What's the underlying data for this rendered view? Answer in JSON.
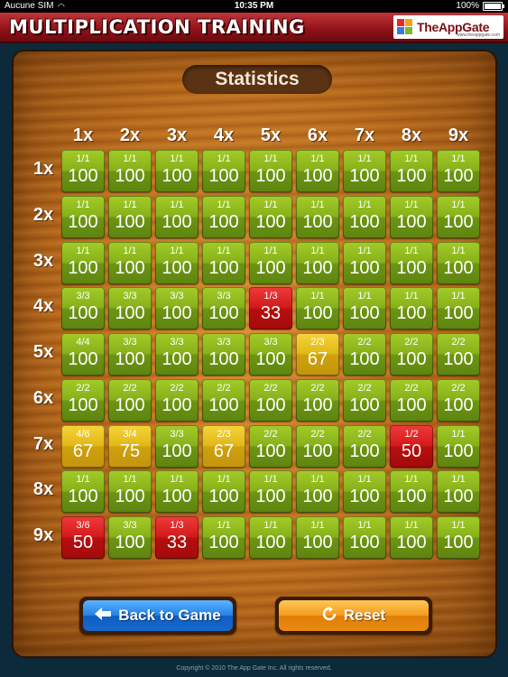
{
  "status": {
    "carrier": "Aucune SIM",
    "time": "10:35 PM",
    "battery": "100%"
  },
  "header": {
    "title": "MULTIPLICATION TRAINING",
    "brand": "TheAppGate",
    "brand_url": "www.theappgate.com"
  },
  "panel_title": "Statistics",
  "columns": [
    "1x",
    "2x",
    "3x",
    "4x",
    "5x",
    "6x",
    "7x",
    "8x",
    "9x"
  ],
  "rows": [
    "1x",
    "2x",
    "3x",
    "4x",
    "5x",
    "6x",
    "7x",
    "8x",
    "9x"
  ],
  "colors": {
    "green": "#86b11a",
    "yellow": "#e2b817",
    "red": "#d41a1a"
  },
  "cells": [
    [
      {
        "f": "1/1",
        "p": "100",
        "c": "green"
      },
      {
        "f": "1/1",
        "p": "100",
        "c": "green"
      },
      {
        "f": "1/1",
        "p": "100",
        "c": "green"
      },
      {
        "f": "1/1",
        "p": "100",
        "c": "green"
      },
      {
        "f": "1/1",
        "p": "100",
        "c": "green"
      },
      {
        "f": "1/1",
        "p": "100",
        "c": "green"
      },
      {
        "f": "1/1",
        "p": "100",
        "c": "green"
      },
      {
        "f": "1/1",
        "p": "100",
        "c": "green"
      },
      {
        "f": "1/1",
        "p": "100",
        "c": "green"
      }
    ],
    [
      {
        "f": "1/1",
        "p": "100",
        "c": "green"
      },
      {
        "f": "1/1",
        "p": "100",
        "c": "green"
      },
      {
        "f": "1/1",
        "p": "100",
        "c": "green"
      },
      {
        "f": "1/1",
        "p": "100",
        "c": "green"
      },
      {
        "f": "1/1",
        "p": "100",
        "c": "green"
      },
      {
        "f": "1/1",
        "p": "100",
        "c": "green"
      },
      {
        "f": "1/1",
        "p": "100",
        "c": "green"
      },
      {
        "f": "1/1",
        "p": "100",
        "c": "green"
      },
      {
        "f": "1/1",
        "p": "100",
        "c": "green"
      }
    ],
    [
      {
        "f": "1/1",
        "p": "100",
        "c": "green"
      },
      {
        "f": "1/1",
        "p": "100",
        "c": "green"
      },
      {
        "f": "1/1",
        "p": "100",
        "c": "green"
      },
      {
        "f": "1/1",
        "p": "100",
        "c": "green"
      },
      {
        "f": "1/1",
        "p": "100",
        "c": "green"
      },
      {
        "f": "1/1",
        "p": "100",
        "c": "green"
      },
      {
        "f": "1/1",
        "p": "100",
        "c": "green"
      },
      {
        "f": "1/1",
        "p": "100",
        "c": "green"
      },
      {
        "f": "1/1",
        "p": "100",
        "c": "green"
      }
    ],
    [
      {
        "f": "3/3",
        "p": "100",
        "c": "green"
      },
      {
        "f": "3/3",
        "p": "100",
        "c": "green"
      },
      {
        "f": "3/3",
        "p": "100",
        "c": "green"
      },
      {
        "f": "3/3",
        "p": "100",
        "c": "green"
      },
      {
        "f": "1/3",
        "p": "33",
        "c": "red"
      },
      {
        "f": "1/1",
        "p": "100",
        "c": "green"
      },
      {
        "f": "1/1",
        "p": "100",
        "c": "green"
      },
      {
        "f": "1/1",
        "p": "100",
        "c": "green"
      },
      {
        "f": "1/1",
        "p": "100",
        "c": "green"
      }
    ],
    [
      {
        "f": "4/4",
        "p": "100",
        "c": "green"
      },
      {
        "f": "3/3",
        "p": "100",
        "c": "green"
      },
      {
        "f": "3/3",
        "p": "100",
        "c": "green"
      },
      {
        "f": "3/3",
        "p": "100",
        "c": "green"
      },
      {
        "f": "3/3",
        "p": "100",
        "c": "green"
      },
      {
        "f": "2/3",
        "p": "67",
        "c": "yellow"
      },
      {
        "f": "2/2",
        "p": "100",
        "c": "green"
      },
      {
        "f": "2/2",
        "p": "100",
        "c": "green"
      },
      {
        "f": "2/2",
        "p": "100",
        "c": "green"
      }
    ],
    [
      {
        "f": "2/2",
        "p": "100",
        "c": "green"
      },
      {
        "f": "2/2",
        "p": "100",
        "c": "green"
      },
      {
        "f": "2/2",
        "p": "100",
        "c": "green"
      },
      {
        "f": "2/2",
        "p": "100",
        "c": "green"
      },
      {
        "f": "2/2",
        "p": "100",
        "c": "green"
      },
      {
        "f": "2/2",
        "p": "100",
        "c": "green"
      },
      {
        "f": "2/2",
        "p": "100",
        "c": "green"
      },
      {
        "f": "2/2",
        "p": "100",
        "c": "green"
      },
      {
        "f": "2/2",
        "p": "100",
        "c": "green"
      }
    ],
    [
      {
        "f": "4/6",
        "p": "67",
        "c": "yellow"
      },
      {
        "f": "3/4",
        "p": "75",
        "c": "yellow"
      },
      {
        "f": "3/3",
        "p": "100",
        "c": "green"
      },
      {
        "f": "2/3",
        "p": "67",
        "c": "yellow"
      },
      {
        "f": "2/2",
        "p": "100",
        "c": "green"
      },
      {
        "f": "2/2",
        "p": "100",
        "c": "green"
      },
      {
        "f": "2/2",
        "p": "100",
        "c": "green"
      },
      {
        "f": "1/2",
        "p": "50",
        "c": "red"
      },
      {
        "f": "1/1",
        "p": "100",
        "c": "green"
      }
    ],
    [
      {
        "f": "1/1",
        "p": "100",
        "c": "green"
      },
      {
        "f": "1/1",
        "p": "100",
        "c": "green"
      },
      {
        "f": "1/1",
        "p": "100",
        "c": "green"
      },
      {
        "f": "1/1",
        "p": "100",
        "c": "green"
      },
      {
        "f": "1/1",
        "p": "100",
        "c": "green"
      },
      {
        "f": "1/1",
        "p": "100",
        "c": "green"
      },
      {
        "f": "1/1",
        "p": "100",
        "c": "green"
      },
      {
        "f": "1/1",
        "p": "100",
        "c": "green"
      },
      {
        "f": "1/1",
        "p": "100",
        "c": "green"
      }
    ],
    [
      {
        "f": "3/6",
        "p": "50",
        "c": "red"
      },
      {
        "f": "3/3",
        "p": "100",
        "c": "green"
      },
      {
        "f": "1/3",
        "p": "33",
        "c": "red"
      },
      {
        "f": "1/1",
        "p": "100",
        "c": "green"
      },
      {
        "f": "1/1",
        "p": "100",
        "c": "green"
      },
      {
        "f": "1/1",
        "p": "100",
        "c": "green"
      },
      {
        "f": "1/1",
        "p": "100",
        "c": "green"
      },
      {
        "f": "1/1",
        "p": "100",
        "c": "green"
      },
      {
        "f": "1/1",
        "p": "100",
        "c": "green"
      }
    ]
  ],
  "buttons": {
    "back": "Back to Game",
    "reset": "Reset"
  },
  "footer": "Copyright © 2010 The App Gate Inc. All rights reserved."
}
